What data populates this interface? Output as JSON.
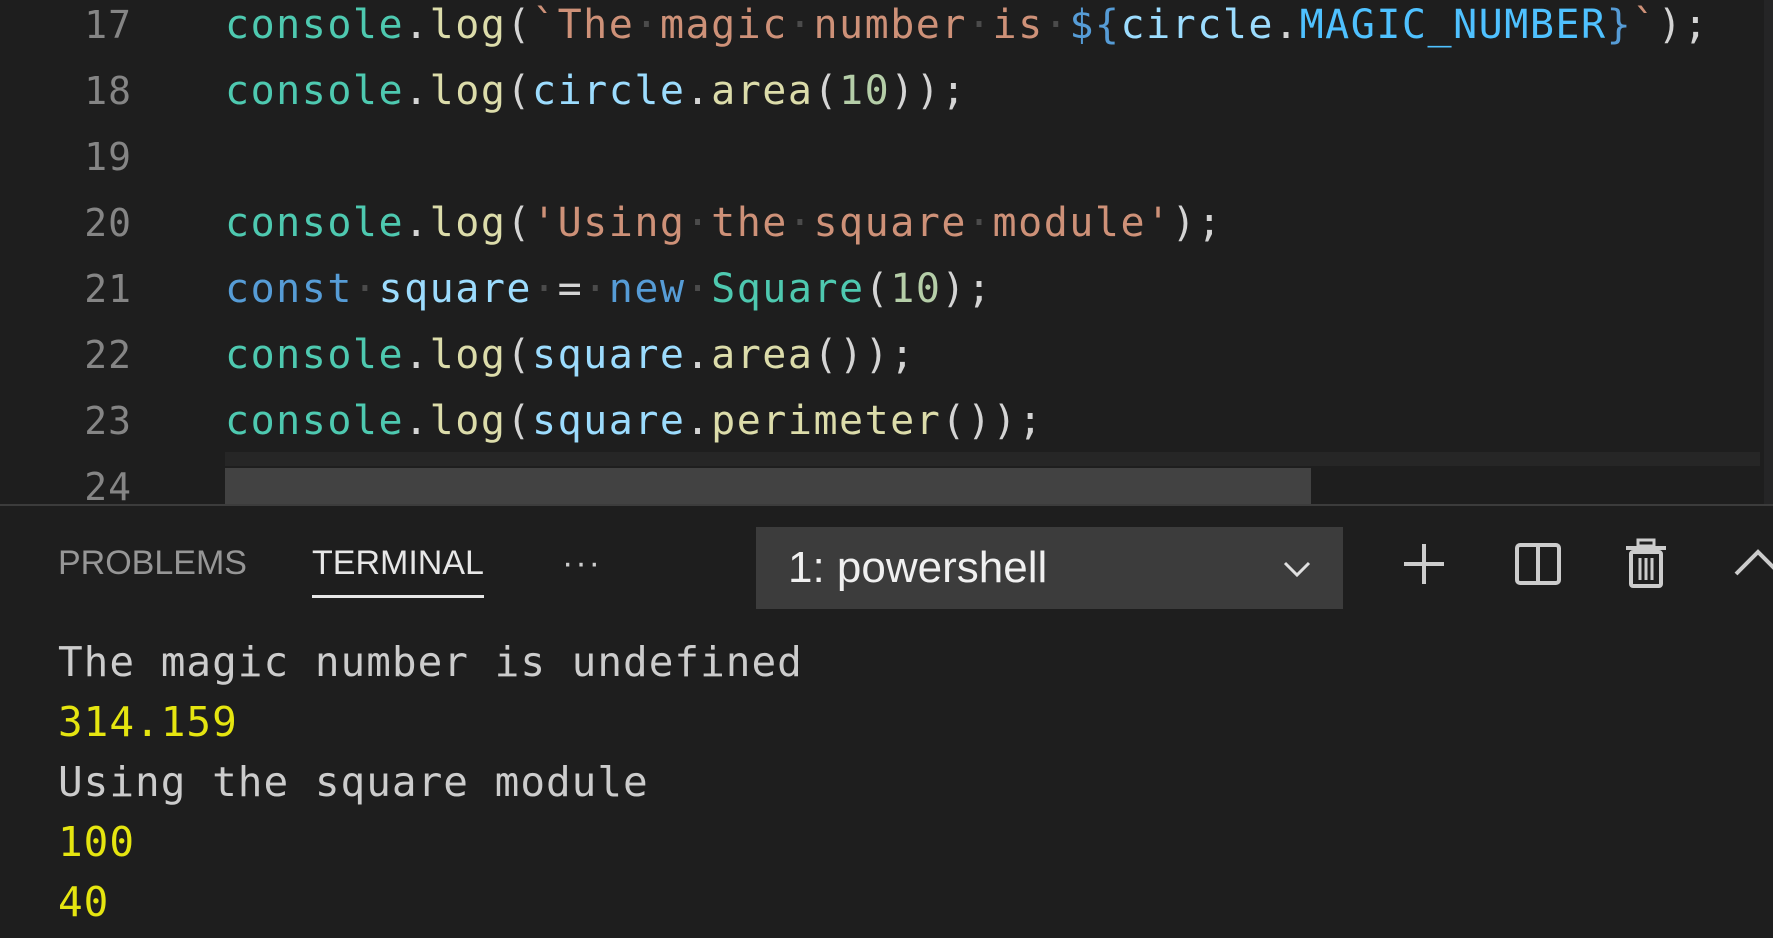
{
  "editor": {
    "lines": [
      {
        "num": "17",
        "tokens": [
          {
            "t": "console",
            "c": "obj"
          },
          {
            "t": ".",
            "c": "p"
          },
          {
            "t": "log",
            "c": "fn"
          },
          {
            "t": "(",
            "c": "p"
          },
          {
            "t": "`The",
            "c": "str"
          },
          {
            "t": "·",
            "c": "ws"
          },
          {
            "t": "magic",
            "c": "str"
          },
          {
            "t": "·",
            "c": "ws"
          },
          {
            "t": "number",
            "c": "str"
          },
          {
            "t": "·",
            "c": "ws"
          },
          {
            "t": "is",
            "c": "str"
          },
          {
            "t": "·",
            "c": "ws"
          },
          {
            "t": "${",
            "c": "kw"
          },
          {
            "t": "circle",
            "c": "var"
          },
          {
            "t": ".",
            "c": "p"
          },
          {
            "t": "MAGIC_NUMBER",
            "c": "const"
          },
          {
            "t": "}",
            "c": "kw"
          },
          {
            "t": "`",
            "c": "str"
          },
          {
            "t": ");",
            "c": "p"
          }
        ]
      },
      {
        "num": "18",
        "tokens": [
          {
            "t": "console",
            "c": "obj"
          },
          {
            "t": ".",
            "c": "p"
          },
          {
            "t": "log",
            "c": "fn"
          },
          {
            "t": "(",
            "c": "p"
          },
          {
            "t": "circle",
            "c": "var"
          },
          {
            "t": ".",
            "c": "p"
          },
          {
            "t": "area",
            "c": "fn"
          },
          {
            "t": "(",
            "c": "p"
          },
          {
            "t": "10",
            "c": "num"
          },
          {
            "t": "));",
            "c": "p"
          }
        ]
      },
      {
        "num": "19",
        "tokens": []
      },
      {
        "num": "20",
        "tokens": [
          {
            "t": "console",
            "c": "obj"
          },
          {
            "t": ".",
            "c": "p"
          },
          {
            "t": "log",
            "c": "fn"
          },
          {
            "t": "(",
            "c": "p"
          },
          {
            "t": "'Using",
            "c": "str"
          },
          {
            "t": "·",
            "c": "ws"
          },
          {
            "t": "the",
            "c": "str"
          },
          {
            "t": "·",
            "c": "ws"
          },
          {
            "t": "square",
            "c": "str"
          },
          {
            "t": "·",
            "c": "ws"
          },
          {
            "t": "module'",
            "c": "str"
          },
          {
            "t": ");",
            "c": "p"
          }
        ]
      },
      {
        "num": "21",
        "tokens": [
          {
            "t": "const",
            "c": "kw"
          },
          {
            "t": "·",
            "c": "ws"
          },
          {
            "t": "square",
            "c": "var"
          },
          {
            "t": "·",
            "c": "ws"
          },
          {
            "t": "=",
            "c": "p"
          },
          {
            "t": "·",
            "c": "ws"
          },
          {
            "t": "new",
            "c": "kw"
          },
          {
            "t": "·",
            "c": "ws"
          },
          {
            "t": "Square",
            "c": "cls"
          },
          {
            "t": "(",
            "c": "p"
          },
          {
            "t": "10",
            "c": "num"
          },
          {
            "t": ");",
            "c": "p"
          }
        ]
      },
      {
        "num": "22",
        "tokens": [
          {
            "t": "console",
            "c": "obj"
          },
          {
            "t": ".",
            "c": "p"
          },
          {
            "t": "log",
            "c": "fn"
          },
          {
            "t": "(",
            "c": "p"
          },
          {
            "t": "square",
            "c": "var"
          },
          {
            "t": ".",
            "c": "p"
          },
          {
            "t": "area",
            "c": "fn"
          },
          {
            "t": "());",
            "c": "p"
          }
        ]
      },
      {
        "num": "23",
        "tokens": [
          {
            "t": "console",
            "c": "obj"
          },
          {
            "t": ".",
            "c": "p"
          },
          {
            "t": "log",
            "c": "fn"
          },
          {
            "t": "(",
            "c": "p"
          },
          {
            "t": "square",
            "c": "var"
          },
          {
            "t": ".",
            "c": "p"
          },
          {
            "t": "perimeter",
            "c": "fn"
          },
          {
            "t": "());",
            "c": "p"
          }
        ]
      },
      {
        "num": "24",
        "tokens": []
      }
    ]
  },
  "panel": {
    "tabs": {
      "problems": "PROBLEMS",
      "terminal": "TERMINAL",
      "more": "···"
    },
    "terminal_select": {
      "value": "1: powershell"
    },
    "actions": {
      "add_icon": "plus-icon",
      "split_icon": "split-icon",
      "trash_icon": "trash-icon",
      "maximize_icon": "chevron-up-icon"
    }
  },
  "terminal": {
    "output": [
      {
        "text": "The magic number is undefined",
        "kind": "text"
      },
      {
        "text": "314.159",
        "kind": "num"
      },
      {
        "text": "Using the square module",
        "kind": "text"
      },
      {
        "text": "100",
        "kind": "num"
      },
      {
        "text": "40",
        "kind": "num"
      }
    ]
  },
  "colors": {
    "background": "#1e1e1e",
    "keyword": "#569cd6",
    "string": "#ce9178",
    "function": "#dcdcaa",
    "type": "#4ec9b0",
    "variable": "#9cdcfe",
    "number": "#b5cea8",
    "terminal_number": "#e5e510"
  }
}
